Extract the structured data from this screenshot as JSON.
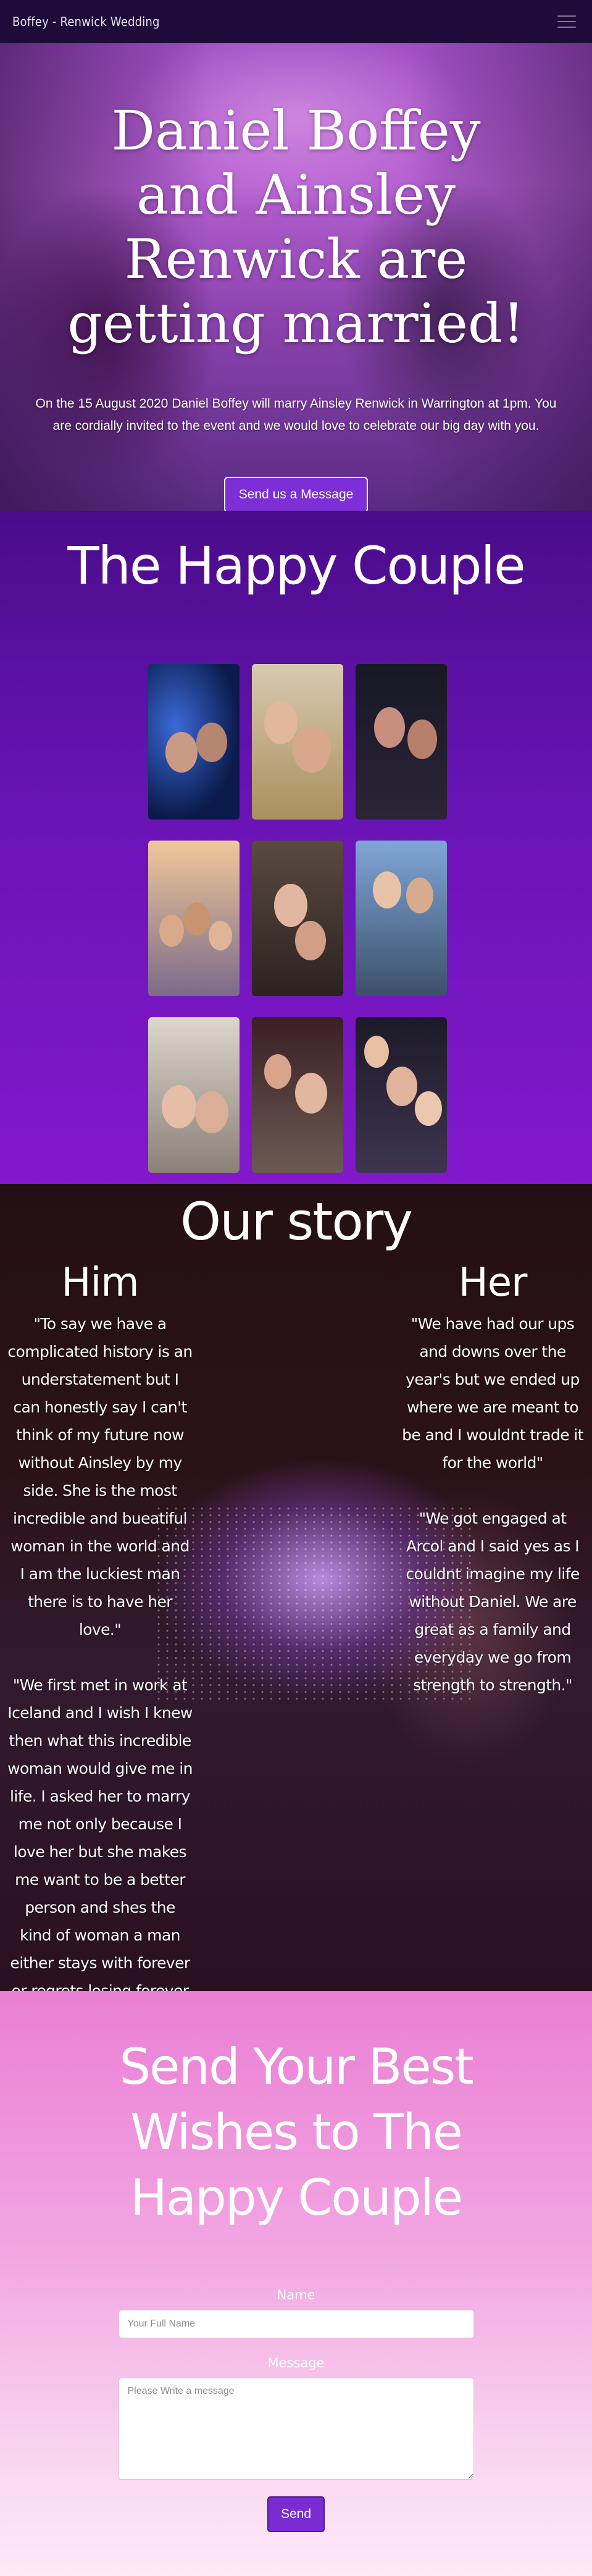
{
  "nav": {
    "brand": "Boffey - Renwick Wedding",
    "menu_icon": "hamburger-menu-icon"
  },
  "hero": {
    "title": "Daniel Boffey and Ainsley Renwick are getting married!",
    "lead": "On the 15 August 2020 Daniel Boffey will marry Ainsley Renwick in Warrington at 1pm. You are cordially invited to the event and we would love to celebrate our big day with you.",
    "button": "Send us a Message"
  },
  "couple": {
    "title": "The Happy Couple",
    "photo_count": 9
  },
  "story": {
    "title": "Our story",
    "him": {
      "heading": "Him",
      "p1": "\"To say we have a complicated history is an understatement but I can honestly say I can't think of my future now without Ainsley by my side. She is the most incredible and bueatiful woman in the world and I am the luckiest man there is to have her love.\"",
      "p2": "\"We first met in work at Iceland and I wish I knew then what this incredible woman would give me in life. I asked her to marry me not only because I love her but she makes me want to be a better person and shes the kind of woman a man either stays with forever or regrets losing forever and I wont be the latter\""
    },
    "her": {
      "heading": "Her",
      "p1": "\"We have had our ups and downs over the year's but we ended up where we are meant to be and I wouldnt trade it for the world\"",
      "p2": "\"We got engaged at Arcol and I said yes as I couldnt imagine my life without Daniel. We are great as a family and everyday we go from strength to strength.\""
    }
  },
  "wishes": {
    "title": "Send Your Best Wishes to The Happy Couple",
    "name_label": "Name",
    "name_placeholder": "Your Full Name",
    "message_label": "Message",
    "message_placeholder": "Please Write a message",
    "send": "Send"
  },
  "colors": {
    "nav_bg": "#1f0b3a",
    "couple_bg": "#6914b6",
    "button": "#7a2bd2",
    "wishes_bg": "#f2a6e2"
  }
}
